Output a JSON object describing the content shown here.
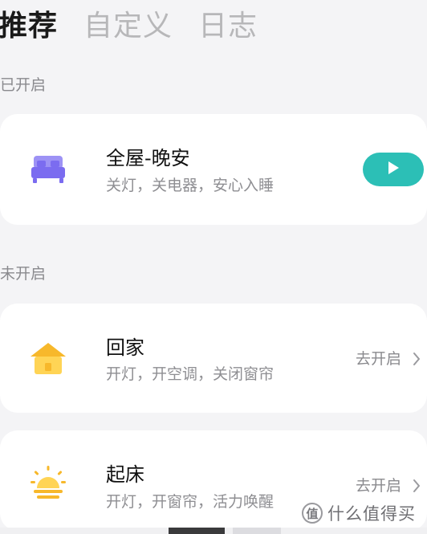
{
  "tabs": [
    {
      "label": "推荐"
    },
    {
      "label": "自定义"
    },
    {
      "label": "日志"
    }
  ],
  "sections": {
    "enabled": {
      "label": "已开启"
    },
    "disabled": {
      "label": "未开启"
    }
  },
  "scenes": [
    {
      "title": "全屋-晚安",
      "subtitle": "关灯，关电器，安心入睡",
      "icon": "bed-icon"
    },
    {
      "title": "回家",
      "subtitle": "开灯，开空调，关闭窗帘",
      "icon": "home-icon",
      "action": "去开启"
    },
    {
      "title": "起床",
      "subtitle": "开灯，开窗帘，活力唤醒",
      "icon": "sunrise-icon",
      "action": "去开启"
    }
  ],
  "watermark": {
    "logo": "值",
    "text": "什么值得买"
  },
  "colors": {
    "accent": "#2cbfb6",
    "bed": "#7b6cf0",
    "home": "#f7b82b",
    "sun": "#f7b82b"
  }
}
